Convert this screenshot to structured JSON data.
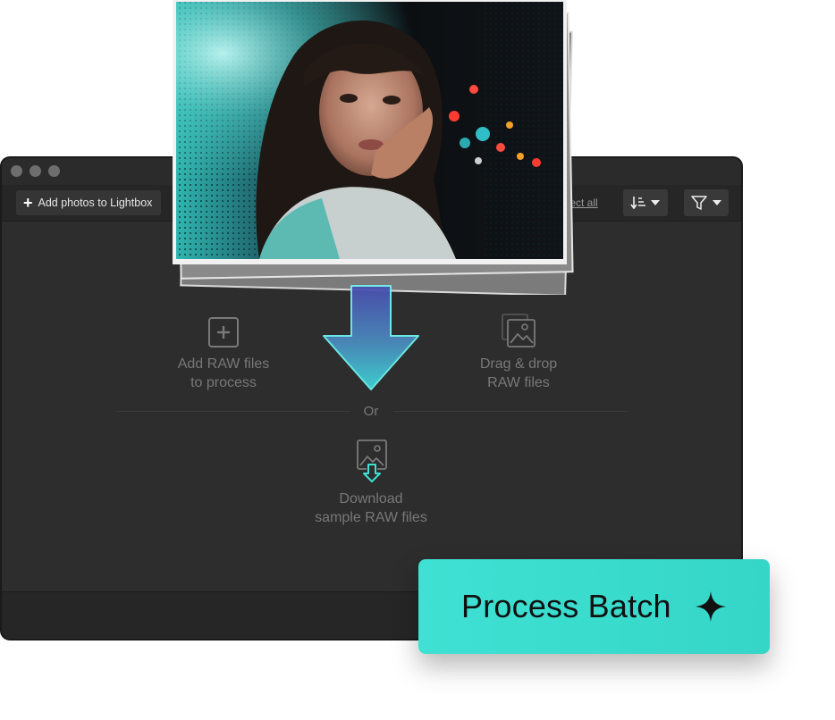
{
  "toolbar": {
    "add_photos_label": "Add photos to Lightbox",
    "select_all_label": "elect all"
  },
  "main": {
    "add_raw": {
      "line1": "Add RAW files",
      "line2": "to process",
      "icon": "plus-square-icon"
    },
    "drag_drop": {
      "line1": "Drag & drop",
      "line2": "RAW files",
      "icon": "image-stack-icon"
    },
    "or_label": "Or",
    "download": {
      "line1": "Download",
      "line2": "sample RAW files",
      "icon": "image-download-icon"
    }
  },
  "process_batch": {
    "label": "Process Batch",
    "icon": "sparkle-icon"
  },
  "colors": {
    "accent": "#3ee1d3",
    "window_bg": "#2d2d2d",
    "toolbar_bg": "#262626",
    "muted_text": "#787878"
  }
}
